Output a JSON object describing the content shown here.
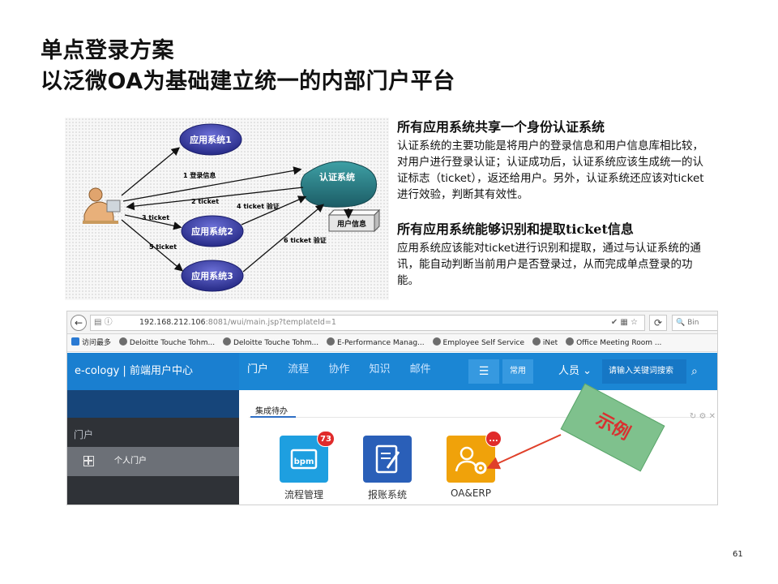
{
  "slide": {
    "title_line1": "单点登录方案",
    "title_line2": "以泛微OA为基础建立统一的内部门户平台",
    "page_number": "61",
    "callout": "示例"
  },
  "diagram": {
    "nodes": {
      "app1": "应用系统1",
      "app2": "应用系统2",
      "app3": "应用系统3",
      "auth": "认证系统",
      "userinfo": "用户信息"
    },
    "arrows": {
      "a1": "1 登录信息",
      "a2": "2 ticket",
      "a3": "3 ticket",
      "a4": "4 ticket 验证",
      "a5": "5 ticket",
      "a6": "6 ticket 验证"
    }
  },
  "desc": {
    "heading1": "所有应用系统共享一个身份认证系统",
    "body1": "认证系统的主要功能是将用户的登录信息和用户信息库相比较，对用户进行登录认证；认证成功后，认证系统应该生成统一的认证标志（ticket），返还给用户。另外，认证系统还应该对ticket进行效验，判断其有效性。",
    "heading2": "所有应用系统能够识别和提取ticket信息",
    "body2": "应用系统应该能对ticket进行识别和提取，通过与认证系统的通讯，能自动判断当前用户是否登录过，从而完成单点登录的功能。"
  },
  "browser": {
    "url_host": "192.168.212.106",
    "url_rest": ":8081/wui/main.jsp?templateId=1",
    "search_placeholder": "Bin",
    "bookmarks": [
      "访问最多",
      "Deloitte Touche Tohm...",
      "Deloitte Touche Tohm...",
      "E-Performance Manag...",
      "Employee Self Service",
      "iNet",
      "Office Meeting Room ..."
    ]
  },
  "app": {
    "brand": "e-cology | 前端用户中心",
    "menu": [
      "门户",
      "流程",
      "协作",
      "知识",
      "邮件"
    ],
    "common": "常用",
    "people": "人员",
    "search_placeholder": "请输入关键词搜索",
    "sidebar_header": "门户",
    "sidebar_item": "个人门户",
    "tab": "集成待办",
    "tiles": [
      {
        "label": "流程管理",
        "badge": "73",
        "color": "#1e9fe0"
      },
      {
        "label": "报账系统",
        "badge": "",
        "color": "#2a5fb8"
      },
      {
        "label": "OA&ERP",
        "badge": "...",
        "color": "#f0a20a"
      }
    ]
  }
}
